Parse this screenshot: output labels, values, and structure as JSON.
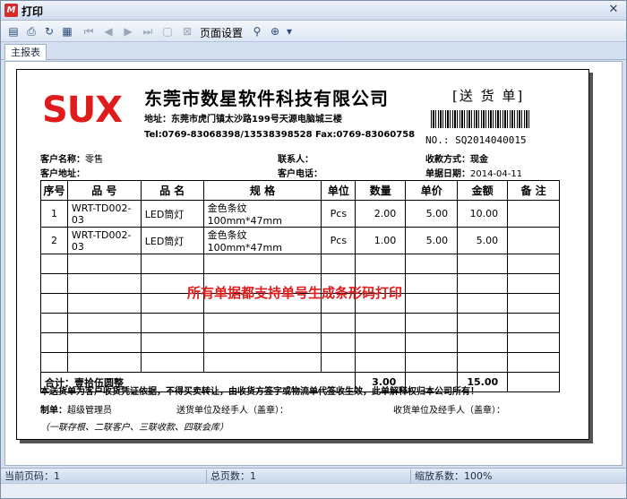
{
  "window": {
    "title": "打印"
  },
  "toolbar": {
    "page_setup_label": "页面设置"
  },
  "tabs": [
    {
      "label": "主报表"
    }
  ],
  "report": {
    "logo_text": "SUX",
    "company_name": "东莞市数星软件科技有限公司",
    "address": "地址：东莞市虎门镇太沙路199号天源电脑城三楼",
    "tel_fax": "Tel:0769-83068398/13538398528  Fax:0769-83060758",
    "doc_title": "[送 货 单]",
    "doc_no": "NO.: SQ2014040015",
    "customer_name_label": "客户名称：",
    "customer_name": "零售",
    "customer_address_label": "客户地址：",
    "contact_label": "联系人：",
    "customer_phone_label": "客户电话：",
    "payment_label": "收款方式：",
    "payment_value": "现金",
    "date_label": "单据日期：",
    "date_value": "2014-04-11",
    "columns": [
      "序号",
      "品 号",
      "品 名",
      "规 格",
      "单位",
      "数量",
      "单价",
      "金额",
      "备 注"
    ],
    "rows": [
      {
        "no": "1",
        "code": "WRT-TD002-03",
        "name": "LED筒灯",
        "spec": "金色条纹100mm*47mm",
        "unit": "Pcs",
        "qty": "2.00",
        "price": "5.00",
        "amount": "10.00",
        "note": ""
      },
      {
        "no": "2",
        "code": "WRT-TD002-03",
        "name": "LED筒灯",
        "spec": "金色条纹100mm*47mm",
        "unit": "Pcs",
        "qty": "1.00",
        "price": "5.00",
        "amount": "5.00",
        "note": ""
      }
    ],
    "total_label": "合计：壹拾伍圆整",
    "total_qty": "3.00",
    "total_amount": "15.00",
    "watermark_text": "所有单据都支持单号生成条形码打印",
    "terms": "本送货单为客户收货凭证依据，不得买卖转让，由收货方签字或物流单代签收生效，此单解释权归本公司所有！",
    "maker_label": "制单：",
    "maker_value": "超级管理员",
    "sender_sign": "送货单位及经手人（盖章）：",
    "receiver_sign": "收货单位及经手人（盖章）：",
    "copies_note": "（一联存根、二联客户、三联收款、四联会库）"
  },
  "status": {
    "current_page": "当前页码：1",
    "total_pages": "总页数：1",
    "zoom": "缩放系数：100%"
  }
}
